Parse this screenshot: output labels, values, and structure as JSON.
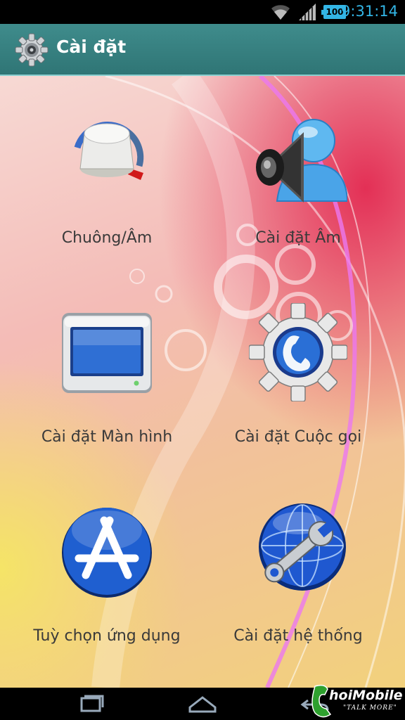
{
  "status_bar": {
    "time": "9:31:14",
    "battery": "100",
    "accent_color": "#33b5e5"
  },
  "action_bar": {
    "title": "Cài đặt",
    "icon": "gear-icon",
    "color": "#3a8585"
  },
  "grid": [
    {
      "label": "Chuông/Âm",
      "icon": "volume-knob-icon"
    },
    {
      "label": "Cài đặt Âm",
      "icon": "speaker-user-icon"
    },
    {
      "label": "Cài đặt Màn hình",
      "icon": "monitor-icon"
    },
    {
      "label": "Cài đặt Cuộc gọi",
      "icon": "call-gear-icon"
    },
    {
      "label": "Tuỳ chọn ứng dụng",
      "icon": "app-store-icon"
    },
    {
      "label": "Cài đặt hệ thống",
      "icon": "globe-wrench-icon"
    }
  ],
  "nav_bar": {
    "buttons": [
      "recent-apps-icon",
      "home-icon",
      "back-icon"
    ]
  },
  "watermark": {
    "brand": "hoiMobile",
    "tagline": "\"TALK MORE\""
  }
}
